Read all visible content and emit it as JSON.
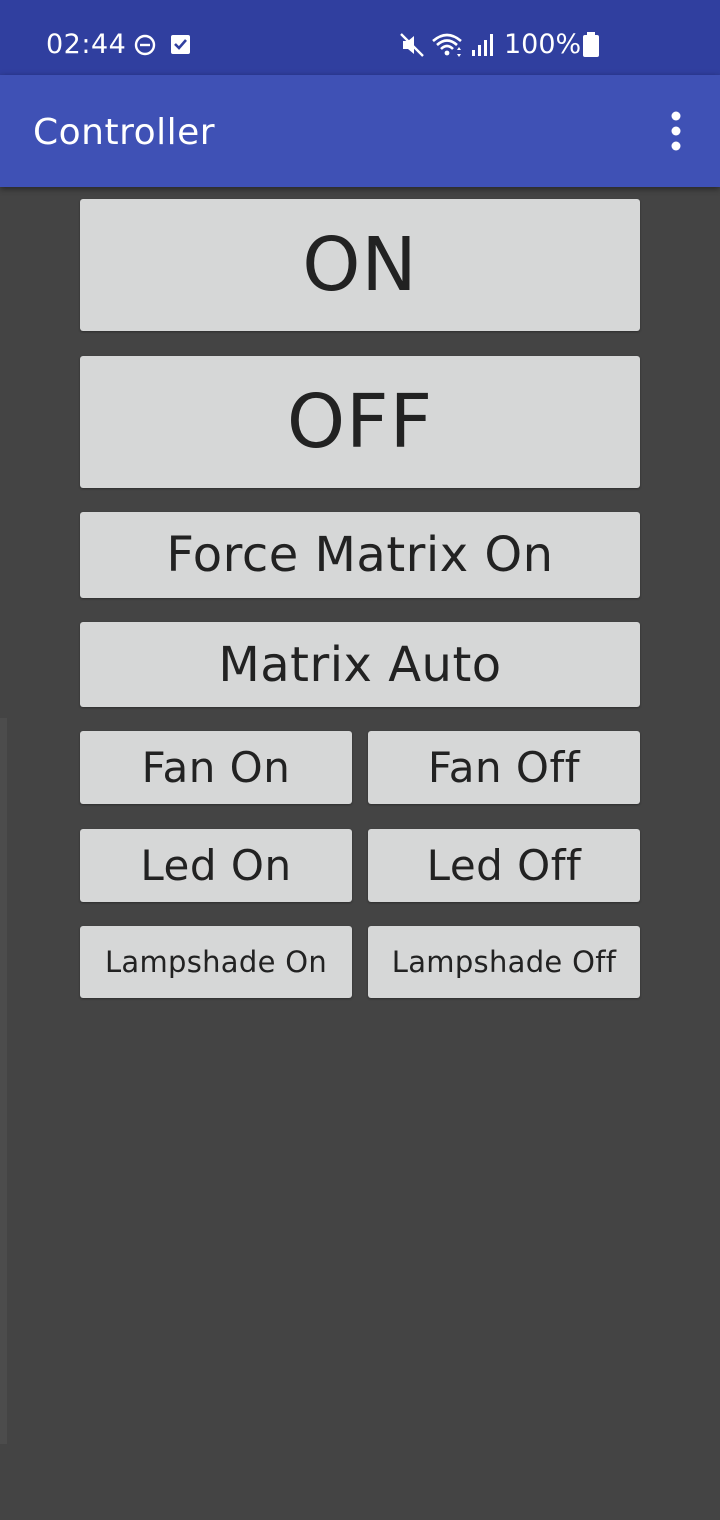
{
  "status_bar": {
    "time": "02:44",
    "battery": "100%",
    "icons": [
      "dnd-icon",
      "checkbox-notification-icon",
      "mute-icon",
      "wifi-icon",
      "signal-icon",
      "battery-icon"
    ]
  },
  "app_bar": {
    "title": "Controller",
    "menu_icon": "more-vert-icon"
  },
  "buttons": {
    "on": "ON",
    "off": "OFF",
    "force_matrix_on": "Force Matrix On",
    "matrix_auto": "Matrix Auto",
    "fan_on": "Fan On",
    "fan_off": "Fan Off",
    "led_on": "Led On",
    "led_off": "Led Off",
    "lampshade_on": "Lampshade On",
    "lampshade_off": "Lampshade Off"
  },
  "colors": {
    "status_bar": "#303f9f",
    "app_bar": "#3f51b5",
    "background": "#444444",
    "button": "#d6d7d7",
    "button_text": "#222222"
  }
}
